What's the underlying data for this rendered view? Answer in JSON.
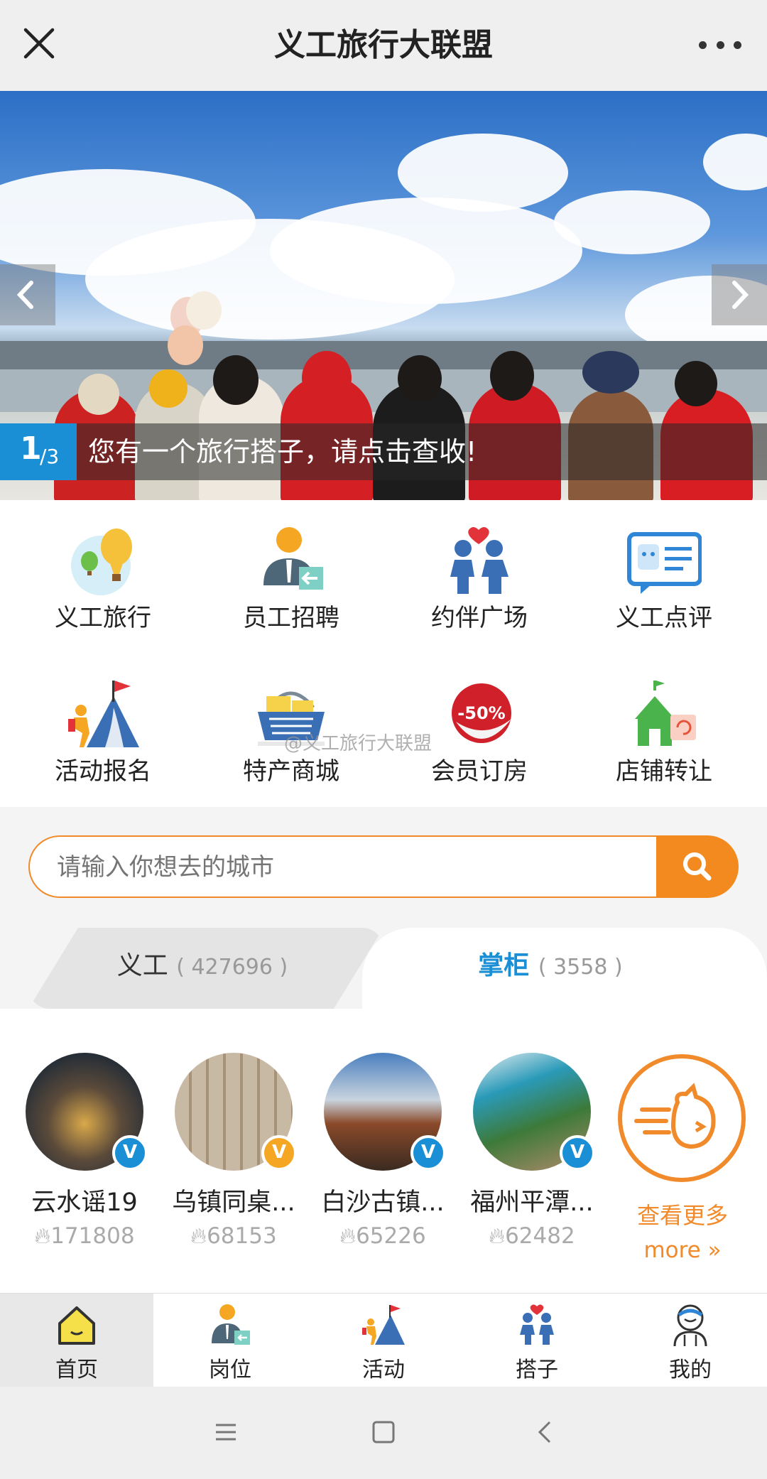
{
  "header": {
    "title": "义工旅行大联盟",
    "close_icon": "close-icon",
    "more_icon": "more-icon"
  },
  "banner": {
    "current": "1",
    "total": "/3",
    "caption": "您有一个旅行搭子，请点击查收!"
  },
  "grid": [
    {
      "label": "义工旅行",
      "icon": "balloon-icon"
    },
    {
      "label": "员工招聘",
      "icon": "recruit-icon"
    },
    {
      "label": "约伴广场",
      "icon": "companions-icon"
    },
    {
      "label": "义工点评",
      "icon": "review-icon"
    },
    {
      "label": "活动报名",
      "icon": "climb-icon"
    },
    {
      "label": "特产商城",
      "icon": "basket-icon"
    },
    {
      "label": "会员订房",
      "icon": "discount-icon"
    },
    {
      "label": "店铺转让",
      "icon": "shop-icon"
    }
  ],
  "watermark": "@义工旅行大联盟",
  "search": {
    "placeholder": "请输入你想去的城市"
  },
  "tabs": [
    {
      "label": "义工",
      "count": "( 427696 )"
    },
    {
      "label": "掌柜",
      "count": "( 3558 )"
    }
  ],
  "hosts": [
    {
      "name": "云水谣19",
      "hot": "171808",
      "badge": "V",
      "badge_color": "#1a8fd6"
    },
    {
      "name": "乌镇同桌...",
      "hot": "68153",
      "badge": "V",
      "badge_color": "#f5a623"
    },
    {
      "name": "白沙古镇...",
      "hot": "65226",
      "badge": "V",
      "badge_color": "#1a8fd6"
    },
    {
      "name": "福州平潭...",
      "hot": "62482",
      "badge": "V",
      "badge_color": "#1a8fd6"
    }
  ],
  "more": {
    "line1": "查看更多",
    "line2": "more »"
  },
  "nav": [
    {
      "label": "首页",
      "icon": "home-icon"
    },
    {
      "label": "岗位",
      "icon": "job-icon"
    },
    {
      "label": "活动",
      "icon": "activity-icon"
    },
    {
      "label": "搭子",
      "icon": "partner-icon"
    },
    {
      "label": "我的",
      "icon": "profile-icon"
    }
  ],
  "colors": {
    "accent": "#f28a20",
    "blue": "#1a8fd6"
  }
}
